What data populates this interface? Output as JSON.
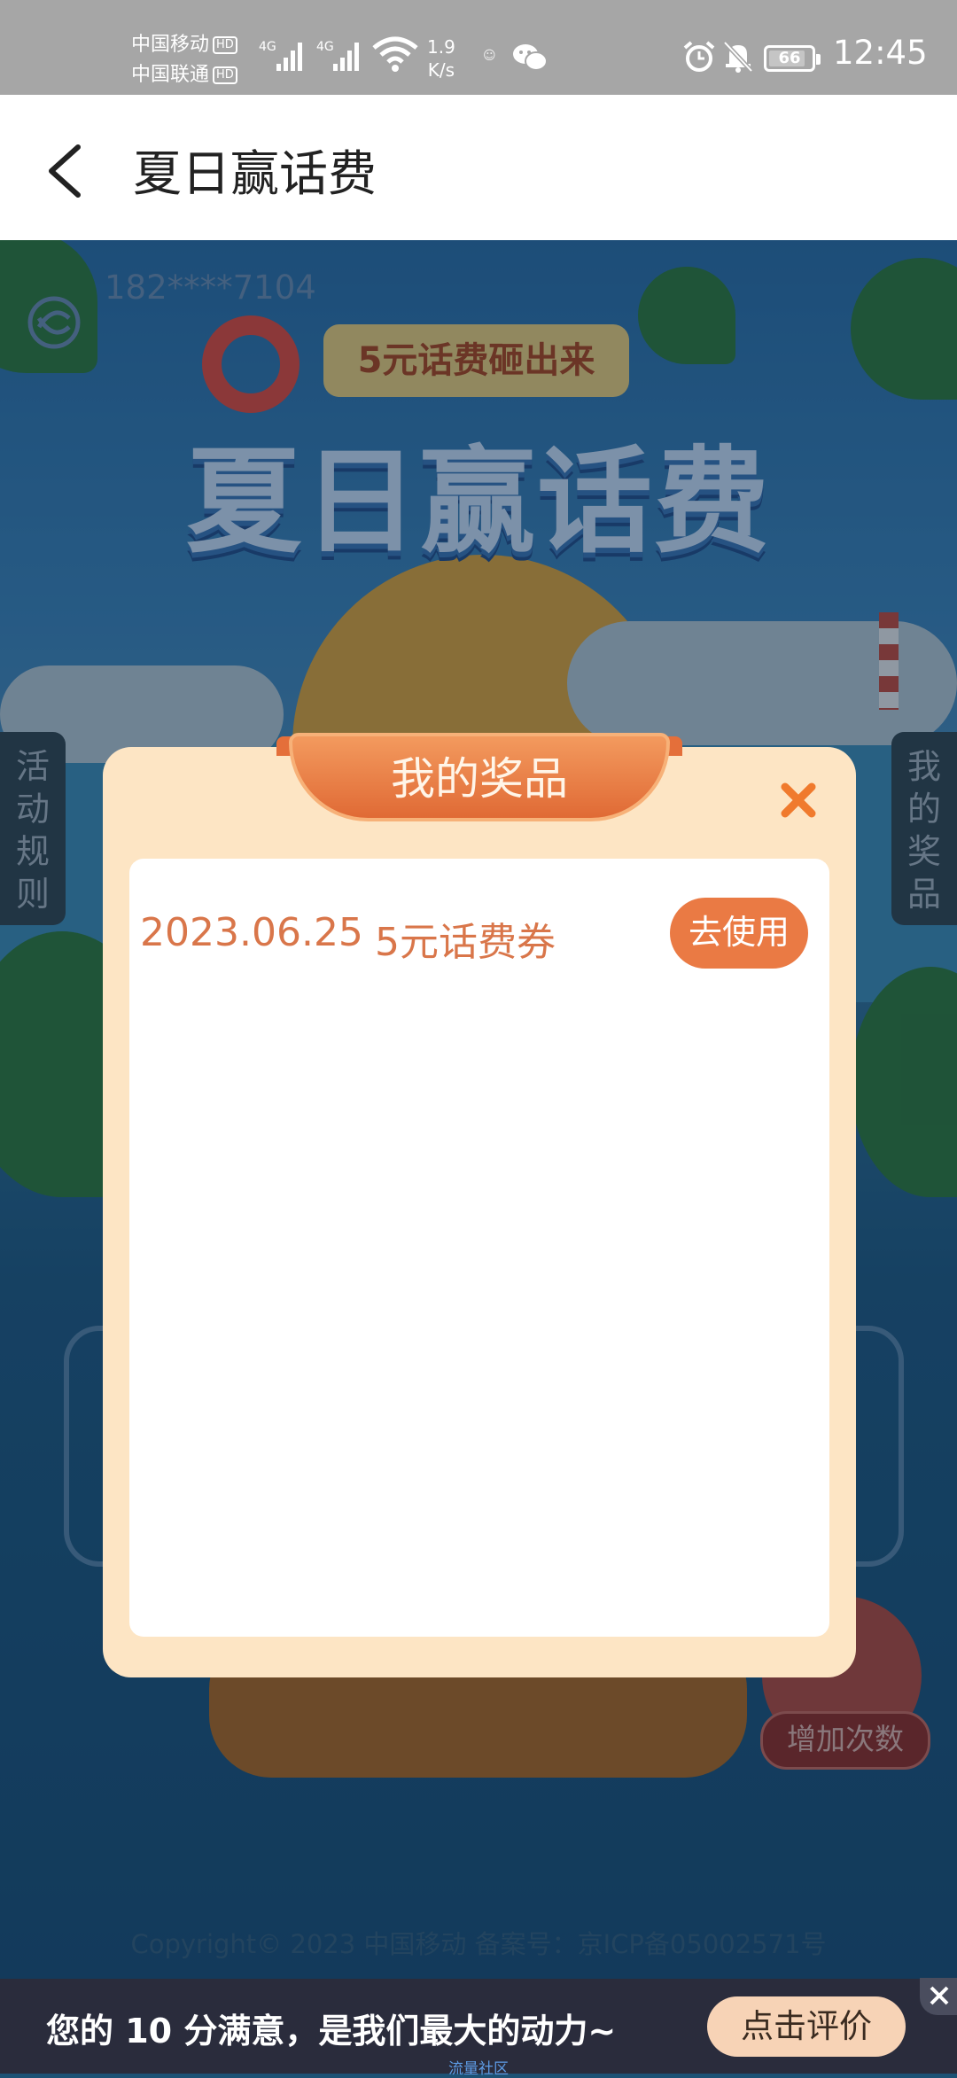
{
  "status_bar": {
    "carrier_1": "中国移动",
    "carrier_2": "中国联通",
    "hd": "HD",
    "net_1": "4G",
    "net_2": "4G",
    "speed_value": "1.9",
    "speed_unit": "K/s",
    "battery": "66",
    "time": "12:45"
  },
  "header": {
    "title": "夏日赢话费"
  },
  "background": {
    "phone_masked": "182****7104",
    "small_banner": "5元话费砸出来",
    "big_title": "夏日赢话费",
    "left_tab": "活动规则",
    "right_tab": "我的奖品",
    "add_times": "增加次数",
    "copyright": "Copyright© 2023 中国移动 备案号：京ICP备05002571号"
  },
  "modal": {
    "title": "我的奖品",
    "prizes": [
      {
        "date": "2023.06.25",
        "name": "5元话费券",
        "action": "去使用"
      }
    ]
  },
  "footer": {
    "text": "您的 10 分满意，是我们最大的动力~",
    "button": "点击评价",
    "sub": "流量社区"
  },
  "colors": {
    "accent": "#ea7a44",
    "modal_bg": "#fde5c4",
    "prize_text": "#d9764a",
    "footer_bg": "#2a2c3c"
  }
}
